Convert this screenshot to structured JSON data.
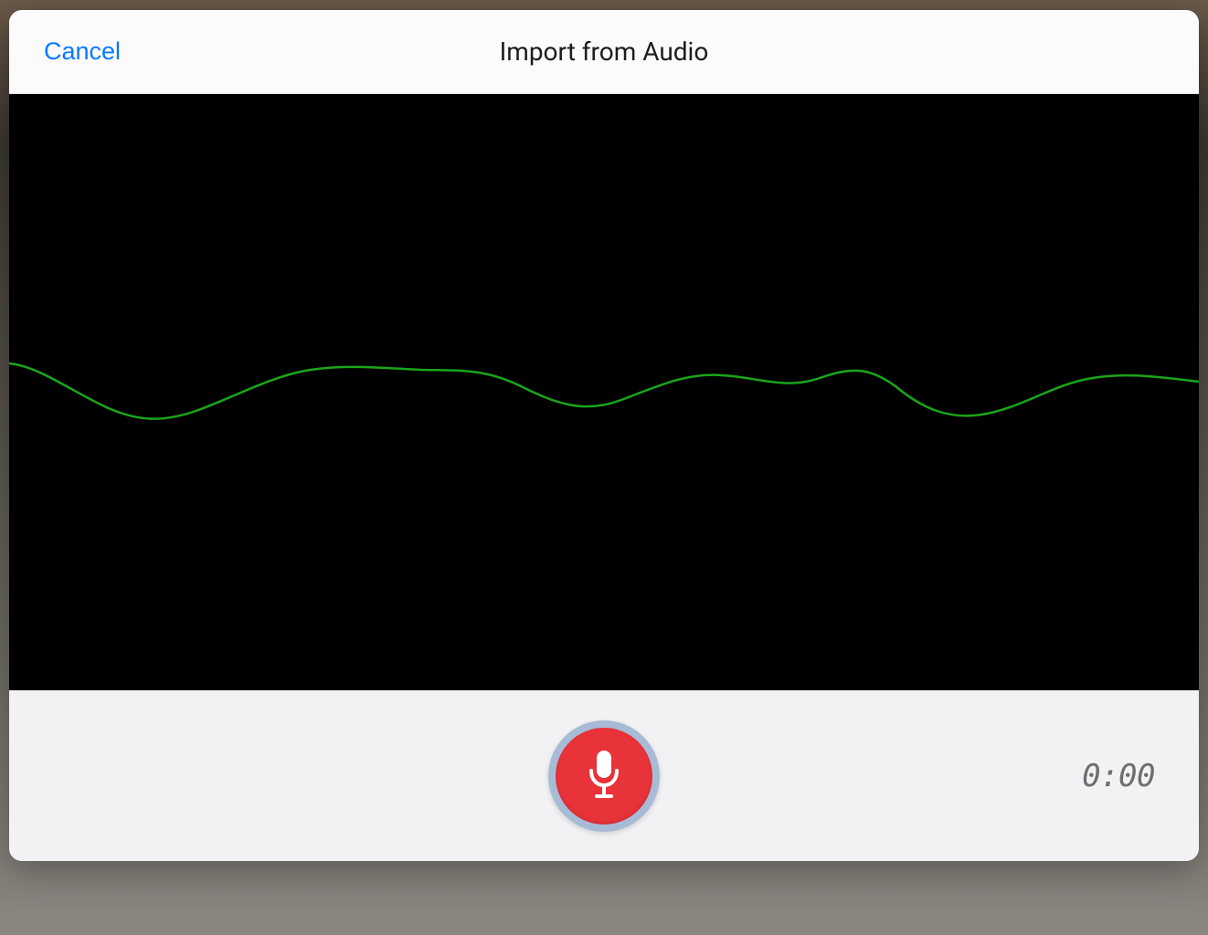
{
  "modal": {
    "title": "Import from Audio",
    "cancel_label": "Cancel"
  },
  "recorder": {
    "timer": "0:00"
  },
  "colors": {
    "accent": "#0a7aff",
    "record": "#e73339",
    "waveform": "#1aa51a"
  }
}
